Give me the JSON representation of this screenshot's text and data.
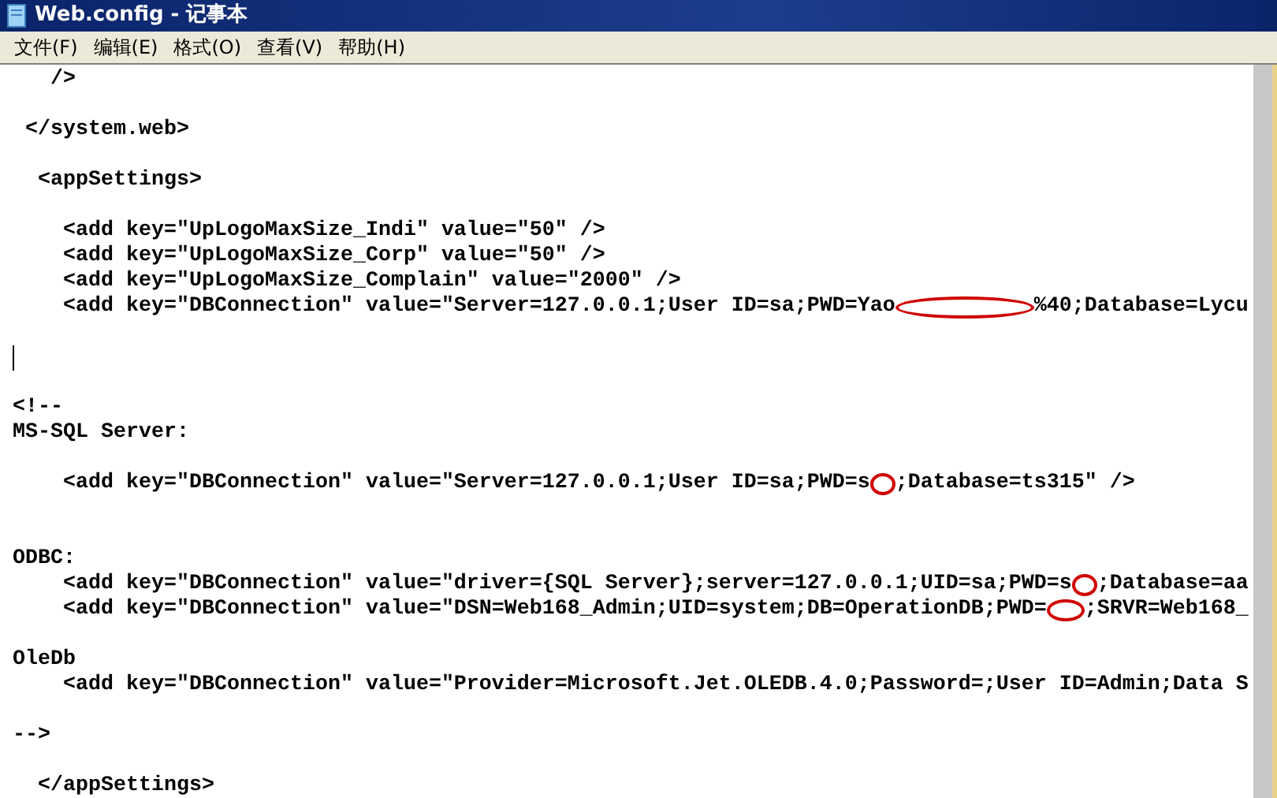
{
  "window": {
    "title": "Web.config - 记事本"
  },
  "menu": [
    {
      "label": "文件(F)"
    },
    {
      "label": "编辑(E)"
    },
    {
      "label": "格式(O)"
    },
    {
      "label": "查看(V)"
    },
    {
      "label": "帮助(H)"
    }
  ],
  "lines": [
    [
      {
        "text": "   />"
      }
    ],
    [
      {
        "kind": "blank"
      }
    ],
    [
      {
        "text": " </system.web>"
      }
    ],
    [
      {
        "kind": "blank"
      }
    ],
    [
      {
        "text": "  <appSettings>"
      }
    ],
    [
      {
        "kind": "blank"
      }
    ],
    [
      {
        "text": "    <add key=\"UpLogoMaxSize_Indi\" value=\"50\" />"
      }
    ],
    [
      {
        "text": "    <add key=\"UpLogoMaxSize_Corp\" value=\"50\" />"
      }
    ],
    [
      {
        "text": "    <add key=\"UpLogoMaxSize_Complain\" value=\"2000\" />"
      }
    ],
    [
      {
        "text": "    <add key=\"DBConnection\" value=\"Server=127.0.0.1;User ID=sa;PWD=Yao"
      },
      {
        "kind": "redaction_wide"
      },
      {
        "text": "%40;Database=Lycu"
      }
    ],
    [
      {
        "kind": "blank"
      }
    ],
    [
      {
        "kind": "cursor"
      }
    ],
    [
      {
        "kind": "blank"
      }
    ],
    [
      {
        "text": "<!--"
      }
    ],
    [
      {
        "text": "MS-SQL Server:"
      }
    ],
    [
      {
        "kind": "blank"
      }
    ],
    [
      {
        "text": "    <add key=\"DBConnection\" value=\"Server=127.0.0.1;User ID=sa;PWD=s"
      },
      {
        "kind": "redaction_small"
      },
      {
        "text": ";Database=ts315\" />"
      }
    ],
    [
      {
        "kind": "blank"
      }
    ],
    [
      {
        "kind": "blank"
      }
    ],
    [
      {
        "text": "ODBC:"
      }
    ],
    [
      {
        "text": "    <add key=\"DBConnection\" value=\"driver={SQL Server};server=127.0.0.1;UID=sa;PWD=s"
      },
      {
        "kind": "redaction_small"
      },
      {
        "text": ";Database=aa"
      }
    ],
    [
      {
        "text": "    <add key=\"DBConnection\" value=\"DSN=Web168_Admin;UID=system;DB=OperationDB;PWD="
      },
      {
        "kind": "redaction_medium"
      },
      {
        "text": ";SRVR=Web168_"
      }
    ],
    [
      {
        "kind": "blank"
      }
    ],
    [
      {
        "text": "OleDb"
      }
    ],
    [
      {
        "text": "    <add key=\"DBConnection\" value=\"Provider=Microsoft.Jet.OLEDB.4.0;Password=;User ID=Admin;Data S"
      }
    ],
    [
      {
        "kind": "blank"
      }
    ],
    [
      {
        "text": "-->"
      }
    ],
    [
      {
        "kind": "blank"
      }
    ],
    [
      {
        "text": "  </appSettings>"
      }
    ]
  ]
}
